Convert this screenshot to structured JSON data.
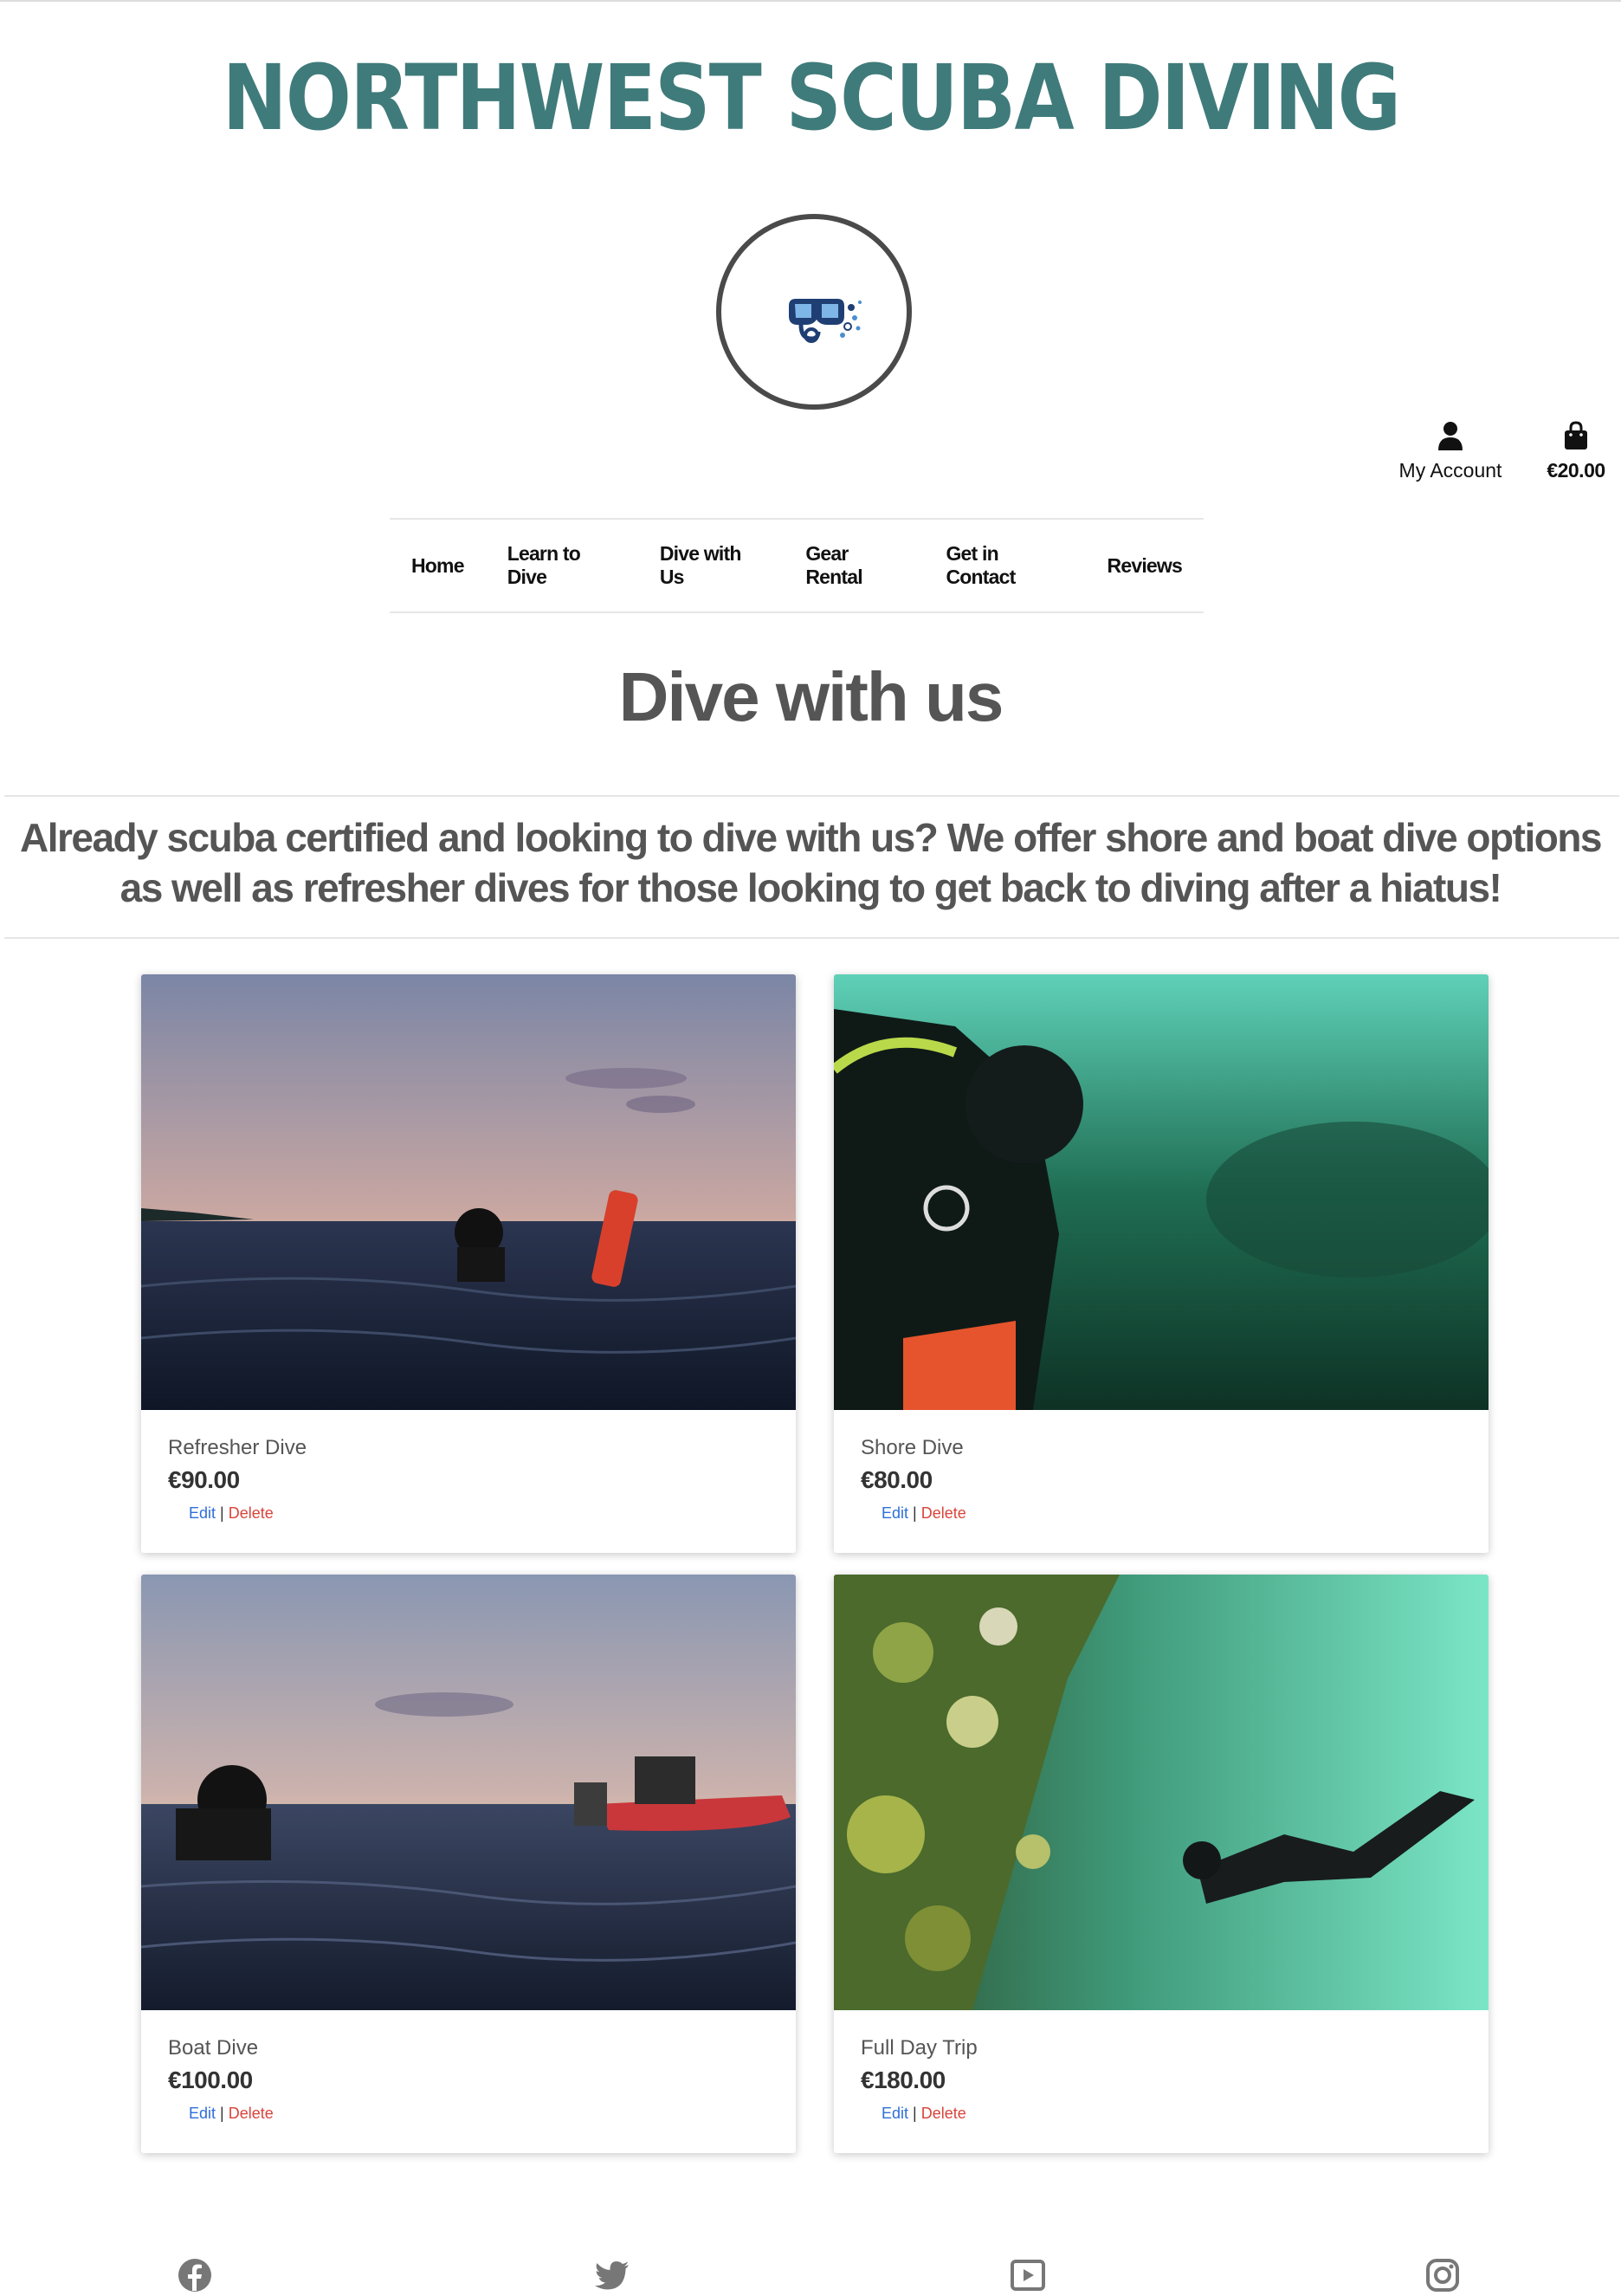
{
  "header": {
    "brand": "NORTHWEST SCUBA DIVING",
    "logo_icon": "dive-mask-icon",
    "account_label": "My Account",
    "account_icon": "user-icon",
    "bag_total": "€20.00",
    "bag_icon": "shopping-bag-icon"
  },
  "nav": {
    "items": [
      {
        "label": "Home"
      },
      {
        "label": "Learn to Dive"
      },
      {
        "label": "Dive with Us"
      },
      {
        "label": "Gear Rental"
      },
      {
        "label": "Get in Contact"
      },
      {
        "label": "Reviews"
      }
    ]
  },
  "page": {
    "title": "Dive with us",
    "intro": "Already scuba certified and looking to dive with us? We offer shore and boat dive options as well as refresher dives for those looking to get back to diving after a hiatus!"
  },
  "products": [
    {
      "name": "Refresher Dive",
      "price": "€90.00",
      "edit": "Edit",
      "separator": "|",
      "delete": "Delete"
    },
    {
      "name": "Shore Dive",
      "price": "€80.00",
      "edit": "Edit",
      "separator": "|",
      "delete": "Delete"
    },
    {
      "name": "Boat Dive",
      "price": "€100.00",
      "edit": "Edit",
      "separator": "|",
      "delete": "Delete"
    },
    {
      "name": "Full Day Trip",
      "price": "€180.00",
      "edit": "Edit",
      "separator": "|",
      "delete": "Delete"
    }
  ],
  "footer": {
    "social": [
      "facebook-icon",
      "twitter-icon",
      "youtube-icon",
      "instagram-icon"
    ]
  },
  "colors": {
    "brand": "#3f7b7a",
    "edit_link": "#2f6fd8",
    "delete_link": "#d9443b"
  }
}
